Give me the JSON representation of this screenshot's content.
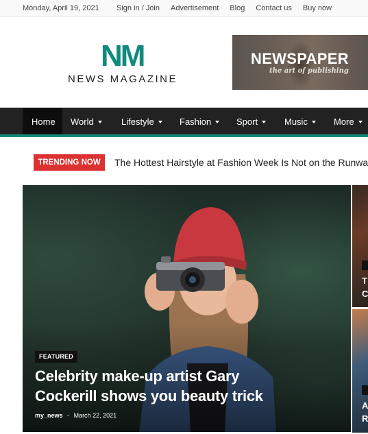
{
  "topbar": {
    "date": "Monday, April 19, 2021",
    "links": [
      "Sign in / Join",
      "Advertisement",
      "Blog",
      "Contact us",
      "Buy now"
    ]
  },
  "logo": {
    "mark": "NM",
    "wordmark": "NEWS MAGAZINE"
  },
  "banner": {
    "title": "NEWSPAPER",
    "subtitle": "the art of publishing"
  },
  "nav": {
    "items": [
      {
        "label": "Home",
        "active": true,
        "has_dropdown": false
      },
      {
        "label": "World",
        "active": false,
        "has_dropdown": true
      },
      {
        "label": "Lifestyle",
        "active": false,
        "has_dropdown": true
      },
      {
        "label": "Fashion",
        "active": false,
        "has_dropdown": true
      },
      {
        "label": "Sport",
        "active": false,
        "has_dropdown": true
      },
      {
        "label": "Music",
        "active": false,
        "has_dropdown": true
      },
      {
        "label": "More",
        "active": false,
        "has_dropdown": true
      }
    ]
  },
  "trending": {
    "badge": "TRENDING NOW",
    "headline": "The Hottest Hairstyle at Fashion Week Is Not on the Runways"
  },
  "featured": {
    "category": "FEATURED",
    "title": "Celebrity make-up artist Gary Cockerill shows you beauty trick",
    "author": "my_news",
    "separator": "-",
    "date": "March 22, 2021"
  },
  "side_posts": [
    {
      "letters": [
        "T",
        "C"
      ]
    },
    {
      "letters": [
        "A",
        "R"
      ]
    }
  ],
  "colors": {
    "accent": "#118a7e",
    "nav_bg": "#222222",
    "trending_badge": "#dc3131"
  }
}
